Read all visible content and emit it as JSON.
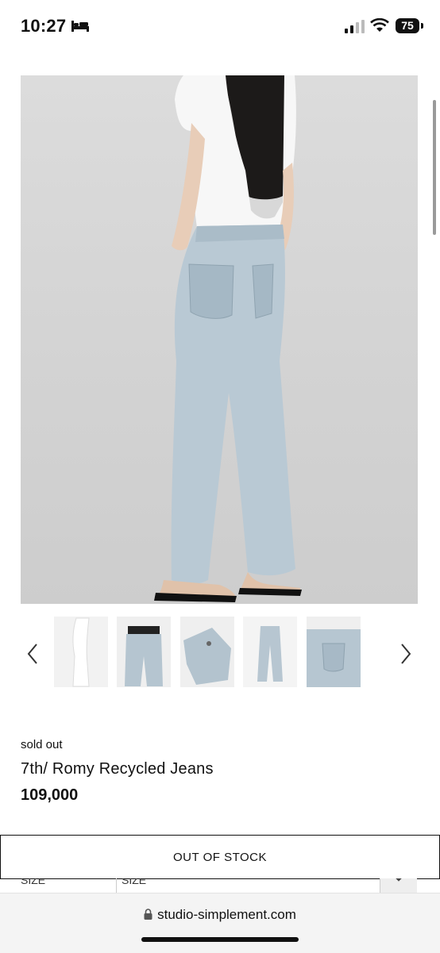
{
  "status_bar": {
    "time": "10:27",
    "battery": "75",
    "icons": [
      "bed-icon",
      "signal-icon",
      "wifi-icon",
      "battery-icon"
    ]
  },
  "gallery": {
    "main_image": "model wearing light blue jeans",
    "thumbnails": [
      "thumbnail-1",
      "thumbnail-2",
      "thumbnail-3",
      "thumbnail-4",
      "thumbnail-5"
    ],
    "prev_icon": "chevron-left-icon",
    "next_icon": "chevron-right-icon"
  },
  "product": {
    "status": "sold out",
    "name": "7th/ Romy Recycled Jeans",
    "price": "109,000"
  },
  "actions": {
    "out_of_stock_label": "OUT OF STOCK"
  },
  "options": {
    "size_label": "SIZE",
    "size_select_value": "SIZE"
  },
  "browser": {
    "url": "studio-simplement.com"
  },
  "colors": {
    "text": "#111111",
    "background": "#ffffff",
    "denim": "#b8c8d2"
  }
}
